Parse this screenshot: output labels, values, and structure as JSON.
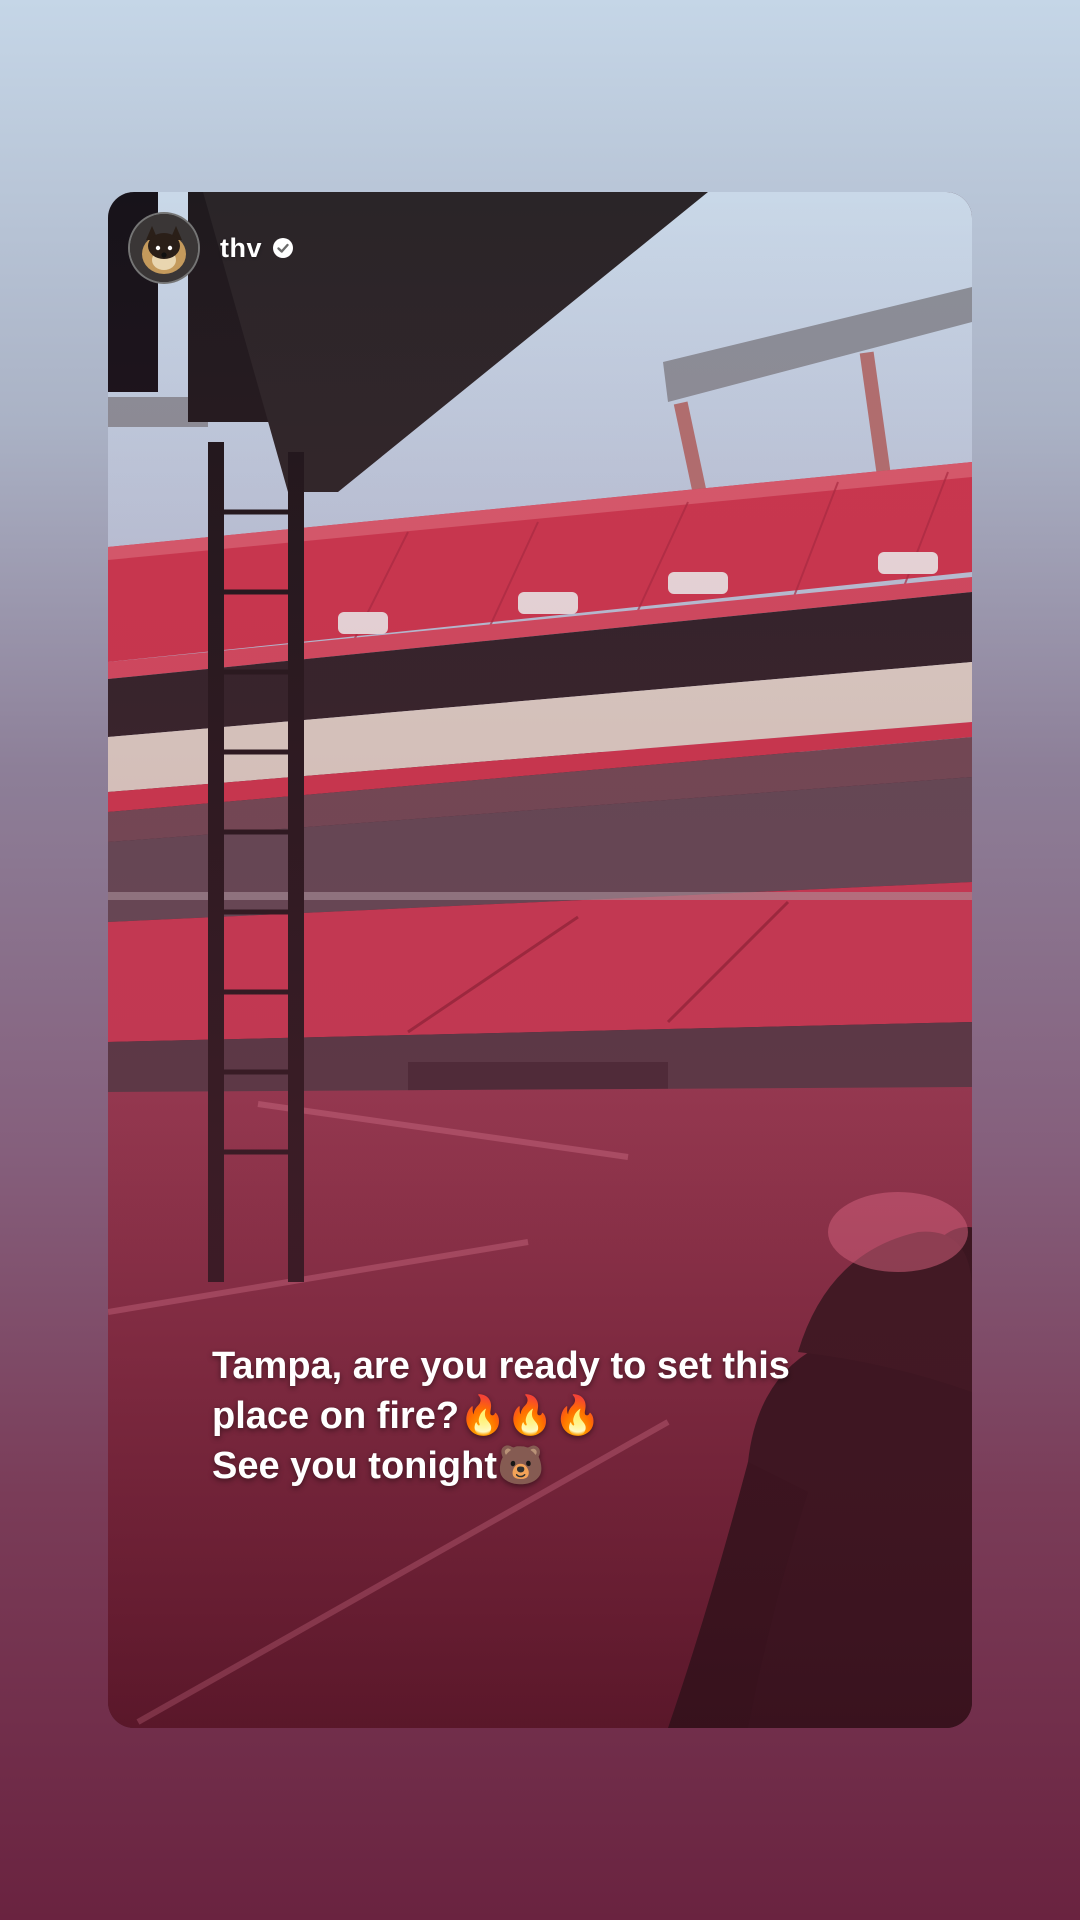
{
  "story": {
    "username": "thv",
    "verified": true,
    "avatar_icon": "pomeranian-dog-avatar",
    "caption": {
      "line1": "Tampa, are you ready to set this",
      "line2_text": "place on fire?",
      "line2_emojis": "🔥🔥🔥",
      "line3_text": "See you tonight",
      "line3_emoji": "🐻"
    }
  },
  "colors": {
    "background_top": "#c5d6e7",
    "background_bottom": "#6a2340",
    "stadium_seats": "#c9374e",
    "text": "#ffffff"
  }
}
